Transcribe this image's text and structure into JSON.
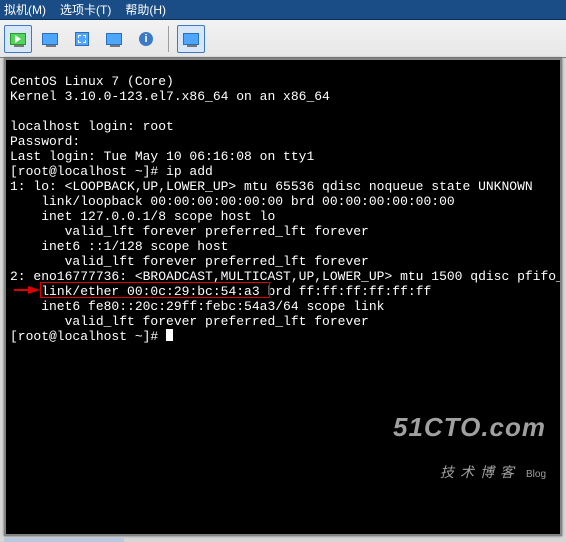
{
  "menu": {
    "vm": "拟机(M)",
    "tabs": "选项卡(T)",
    "help": "帮助(H)"
  },
  "toolbar": {
    "play": "power-on",
    "mon1": "monitor-1",
    "mon2": "monitor-2",
    "full": "fullscreen",
    "info": "i",
    "mon3": "monitor-3"
  },
  "terminal": {
    "line0": "CentOS Linux 7 (Core)",
    "line1": "Kernel 3.10.0-123.el7.x86_64 on an x86_64",
    "line2": "",
    "line3": "localhost login: root",
    "line4": "Password:",
    "line5": "Last login: Tue May 10 06:16:08 on tty1",
    "line6": "[root@localhost ~]# ip add",
    "line7": "1: lo: <LOOPBACK,UP,LOWER_UP> mtu 65536 qdisc noqueue state UNKNOWN",
    "line8": "    link/loopback 00:00:00:00:00:00 brd 00:00:00:00:00:00",
    "line9": "    inet 127.0.0.1/8 scope host lo",
    "line10": "       valid_lft forever preferred_lft forever",
    "line11": "    inet6 ::1/128 scope host",
    "line12": "       valid_lft forever preferred_lft forever",
    "line13": "2: eno16777736: <BROADCAST,MULTICAST,UP,LOWER_UP> mtu 1500 qdisc pfifo_",
    "line14_pre": "    ",
    "line14_hl": "link/ether 00:0c:29:bc:54:a3 ",
    "line14_post": "brd ff:ff:ff:ff:ff:ff",
    "line15": "    inet6 fe80::20c:29ff:febc:54a3/64 scope link",
    "line16": "       valid_lft forever preferred_lft forever",
    "line17": "[root@localhost ~]# "
  },
  "highlight": {
    "mac": "00:0c:29:bc:54:a3"
  },
  "watermark": {
    "main": "51CTO.com",
    "sub": "技术博客",
    "blog": "Blog"
  }
}
